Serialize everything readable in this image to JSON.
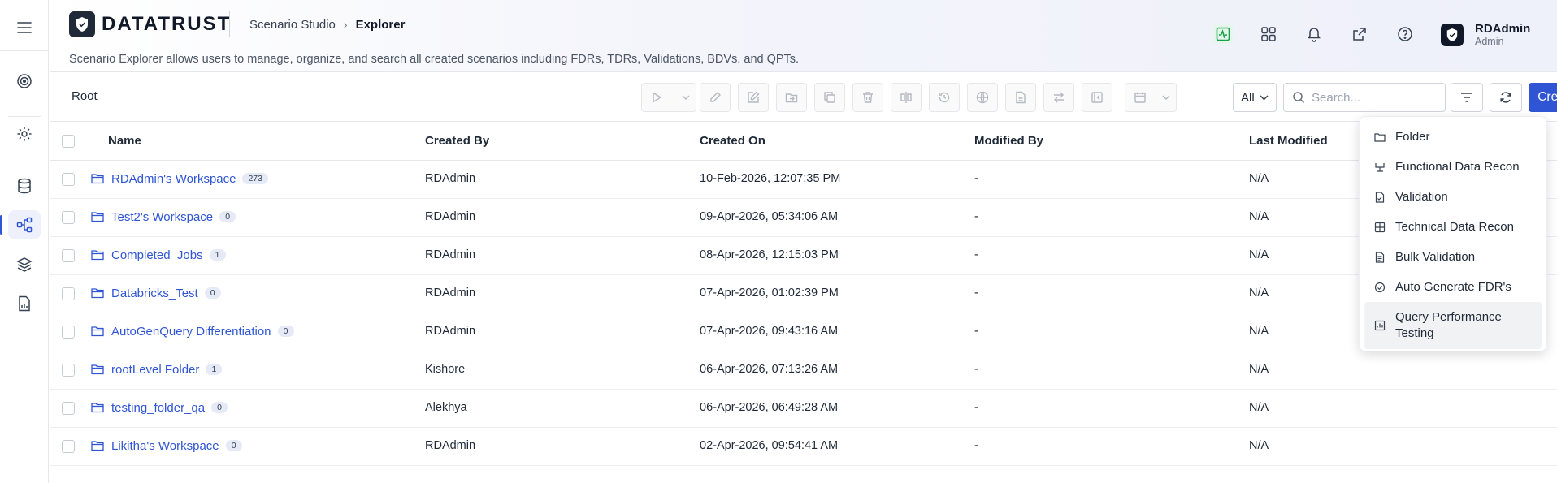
{
  "brand": {
    "name": "DATATRUST"
  },
  "breadcrumb": {
    "parent": "Scenario Studio",
    "current": "Explorer"
  },
  "subtitle": "Scenario Explorer allows users to manage, organize, and search all created scenarios including FDRs, TDRs, Validations, BDVs, and QPTs.",
  "user": {
    "name": "RDAdmin",
    "role": "Admin"
  },
  "colors": {
    "accent": "#2f55d4",
    "link": "#2f55d4",
    "header_bg": "#eef0fa",
    "badge_bg": "#e6eaf7"
  },
  "rail": {
    "items": [
      "menu-icon",
      "target-icon",
      "settings-icon",
      "database-icon",
      "explorer-icon",
      "layers-icon",
      "report-icon"
    ],
    "active": "explorer-icon"
  },
  "header_icons": [
    "activity-icon",
    "apps-grid-icon",
    "bell-icon",
    "external-link-icon",
    "help-icon"
  ],
  "toolbar": {
    "path": "Root",
    "filter_value": "All",
    "search_placeholder": "Search...",
    "create_label": "Create",
    "actions": [
      "run-icon",
      "edit-icon",
      "edit-box-icon",
      "move-icon",
      "copy-icon",
      "delete-icon",
      "compare-icon",
      "history-icon",
      "globe-icon",
      "document-icon",
      "swap-icon",
      "collapse-icon",
      "calendar-icon"
    ]
  },
  "table": {
    "columns": [
      "Name",
      "Created By",
      "Created On",
      "Modified By",
      "Last Modified"
    ],
    "rows": [
      {
        "name": "RDAdmin's Workspace",
        "count": "273",
        "created_by": "RDAdmin",
        "created_on": "10-Feb-2026, 12:07:35 PM",
        "modified_by": "-",
        "last_modified": "N/A"
      },
      {
        "name": "Test2's Workspace",
        "count": "0",
        "created_by": "RDAdmin",
        "created_on": "09-Apr-2026, 05:34:06 AM",
        "modified_by": "-",
        "last_modified": "N/A"
      },
      {
        "name": "Completed_Jobs",
        "count": "1",
        "created_by": "RDAdmin",
        "created_on": "08-Apr-2026, 12:15:03 PM",
        "modified_by": "-",
        "last_modified": "N/A"
      },
      {
        "name": "Databricks_Test",
        "count": "0",
        "created_by": "RDAdmin",
        "created_on": "07-Apr-2026, 01:02:39 PM",
        "modified_by": "-",
        "last_modified": "N/A"
      },
      {
        "name": "AutoGenQuery Differentiation",
        "count": "0",
        "created_by": "RDAdmin",
        "created_on": "07-Apr-2026, 09:43:16 AM",
        "modified_by": "-",
        "last_modified": "N/A"
      },
      {
        "name": "rootLevel Folder",
        "count": "1",
        "created_by": "Kishore",
        "created_on": "06-Apr-2026, 07:13:26 AM",
        "modified_by": "-",
        "last_modified": "N/A"
      },
      {
        "name": "testing_folder_qa",
        "count": "0",
        "created_by": "Alekhya",
        "created_on": "06-Apr-2026, 06:49:28 AM",
        "modified_by": "-",
        "last_modified": "N/A"
      },
      {
        "name": "Likitha's Workspace",
        "count": "0",
        "created_by": "RDAdmin",
        "created_on": "02-Apr-2026, 09:54:41 AM",
        "modified_by": "-",
        "last_modified": "N/A"
      }
    ]
  },
  "create_menu": {
    "items": [
      {
        "label": "Folder",
        "icon": "folder-icon"
      },
      {
        "label": "Functional Data Recon",
        "icon": "recon-icon"
      },
      {
        "label": "Validation",
        "icon": "validation-icon"
      },
      {
        "label": "Technical Data Recon",
        "icon": "technical-icon"
      },
      {
        "label": "Bulk Validation",
        "icon": "bulk-icon"
      },
      {
        "label": "Auto Generate FDR's",
        "icon": "auto-generate-icon"
      },
      {
        "label": "Query Performance Testing",
        "icon": "query-performance-icon"
      }
    ],
    "highlighted": "Query Performance Testing"
  }
}
